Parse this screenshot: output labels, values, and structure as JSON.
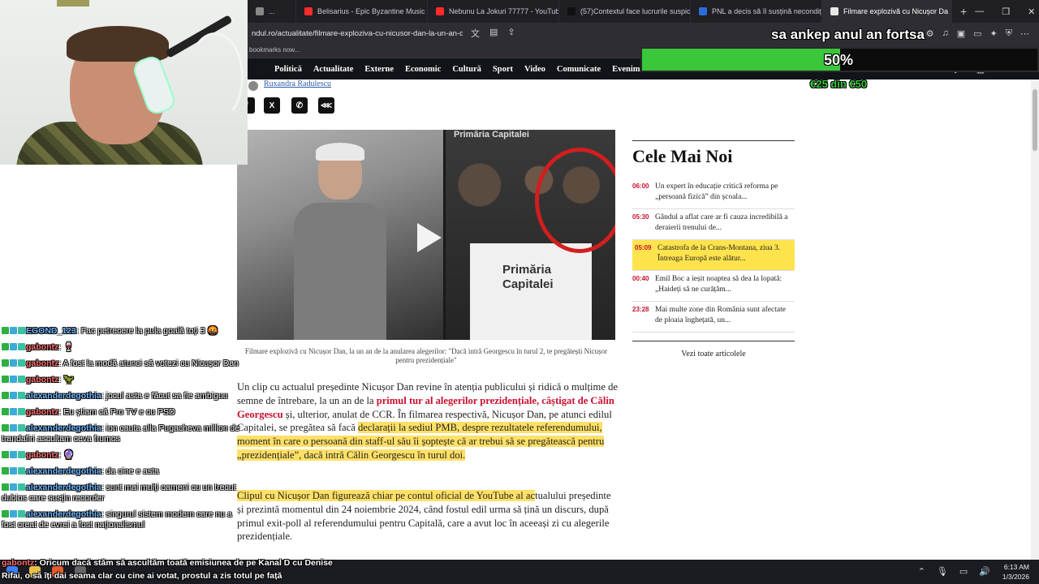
{
  "browser": {
    "tabs": [
      {
        "label": "...",
        "favicon_color": "#888888",
        "active": false
      },
      {
        "label": "Belisarius - Epic Byzantine Music - Yo",
        "favicon_color": "#ff2a2a",
        "active": false
      },
      {
        "label": "Nebunu La Jokuri 77777 - YouTube",
        "favicon_color": "#ff2a2a",
        "active": false
      },
      {
        "label": "(57)Contextul face lucrurile suspicioa",
        "favicon_color": "#111111",
        "active": false
      },
      {
        "label": "PNL a decis să îl susțină necondiționa",
        "favicon_color": "#2b6cd8",
        "active": false
      },
      {
        "label": "Filmare explozivă cu Nicușor Da",
        "favicon_color": "#e8e8e8",
        "active": true
      }
    ],
    "url": "ndul.ro/actualitate/filmare-exploziva-cu-nicusor-dan-la-un-an-de-la-anularea-alegerilor-daca-intra-georgescu-in-turul-2-te-pregatesti-...",
    "bookmarks_text": "bookmarks now..."
  },
  "site_nav": {
    "items": [
      "Politică",
      "Actualitate",
      "Externe",
      "Economic",
      "Cultură",
      "Sport",
      "Video",
      "Comunicate",
      "Evenimente"
    ]
  },
  "article": {
    "author": "Ruxandra Radulescu",
    "share_buttons": [
      "x-icon",
      "whatsapp-icon",
      "share-icon"
    ],
    "hero_sign": "Primăria Capitalei",
    "caption": "Filmare explozivă cu Nicușor Dan, la un an de la anularea alegerilor: \"Dacă intră Georgescu în turul 2, te pregătești Nicușor pentru prezidențiale\"",
    "p1": {
      "a": "Un clip cu actualul președinte Nicușor Dan revine în atenția publicului și ridică o mulțime de semne de întrebare, la un an de la ",
      "link": "primul tur al alegerilor prezidențiale, câștigat de Călin Georgescu",
      "b": " și, ulterior, anulat de CCR. În filmarea respectivă, Nicușor Dan, pe atunci edilul Capitalei, se pregătea să facă ",
      "highlight": "declarații la sediul PMB, despre rezultatele referendumului, moment în care o persoană din staff-ul său îi șoptește că ar trebui să se pregătească pentru „prezidențiale”, dacă intră Călin Georgescu în turul doi."
    },
    "p2": {
      "highlight": "Clipul cu Nicușor Dan figurează chiar pe contul oficial de YouTube al ac",
      "rest": "tualului președinte și prezintă momentul din 24 noiembrie 2024, când fostul edil urma să țină un discurs, după primul exit-poll al referendumului pentru Capitală, care a avut loc în aceeași zi cu alegerile prezidențiale."
    }
  },
  "sidebar": {
    "title": "Cele Mai Noi",
    "items": [
      {
        "time": "06:00",
        "text": "Un expert în educație critică reforma pe „persoană fizică” din școala..."
      },
      {
        "time": "05:30",
        "text": "Gândul a aflat care ar fi cauza incredibilă a deraierii trenului de..."
      },
      {
        "time": "05:09",
        "text": "Catastrofa de la Crans-Montana, ziua 3. Întreaga Europă este alătur..."
      },
      {
        "time": "00:40",
        "text": "Emil Boc a ieșit noaptea să dea la lopată: „Haideți să ne curățăm..."
      },
      {
        "time": "23:28",
        "text": "Mai multe zone din România sunt afectate de ploaia înghețată, un..."
      }
    ],
    "see_all": "Vezi toate articolele"
  },
  "stream": {
    "goal_text": "sa ankep anul an fortsa",
    "goal_fraction": 0.5,
    "goal_percent": "50%",
    "goal_amount": "€25 din €50",
    "chat": [
      {
        "user": "EGOND_123",
        "user_color": "#6fb7ff",
        "text": ": Fac petrecere la pula goală toți 3 🤬"
      },
      {
        "user": "gabontz",
        "user_color": "#ff7070",
        "text": ": 🍷"
      },
      {
        "user": "gabontz",
        "user_color": "#ff7070",
        "text": ": A fost la modă atunci să votezi cu Nicușor Dan"
      },
      {
        "user": "gabontz",
        "user_color": "#ff7070",
        "text": ": 🦖"
      },
      {
        "user": "alexanderdegothia",
        "user_color": "#6fb7ff",
        "text": ": jocul asta e făcut sa fie ambiguu"
      },
      {
        "user": "gabontz",
        "user_color": "#ff7070",
        "text": ": Eu știam că Pro TV e cu PSD"
      },
      {
        "user": "alexanderdegothia",
        "user_color": "#6fb7ff",
        "text": ": ion cauta alla Pugacheva million de trandafiri ascultam ceva frumos"
      },
      {
        "user": "gabontz",
        "user_color": "#ff7070",
        "text": ": 🔮"
      },
      {
        "user": "alexanderdegothia",
        "user_color": "#6fb7ff",
        "text": ": da cine e asta"
      },
      {
        "user": "alexanderdegothia",
        "user_color": "#6fb7ff",
        "text": ": sunt mai mulți oameni cu un trecut dubios care susțin recorder"
      },
      {
        "user": "alexanderdegothia",
        "user_color": "#6fb7ff",
        "text": ": singurul sistem modern care nu a fost creat de evrei a fost naționalismul"
      }
    ],
    "ticker": {
      "user": "gabontz",
      "text": ": Oricum dacă stăm să ascultăm toată emisiunea de pe Kanal D cu Denise Rifai, o să îți dai seama clar cu cine ai votat, prostul a zis totul pe față"
    }
  },
  "taskbar": {
    "time": "6:13 AM",
    "date": "1/3/2026"
  },
  "colors": {
    "accent_red": "#c8102e",
    "highlight": "#ffe066",
    "goal_green": "#3ac73a"
  }
}
